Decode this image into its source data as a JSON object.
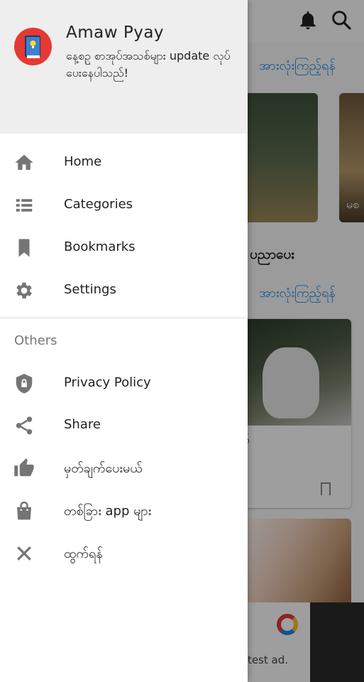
{
  "drawer": {
    "app_name": "Amaw Pyay",
    "subtitle": "နေ့စဥ္ စာအုပ်အသစ်များ update လုပ်ပေးနေပါသည်!",
    "main_items": [
      {
        "label": "Home",
        "icon": "home-icon"
      },
      {
        "label": "Categories",
        "icon": "list-icon"
      },
      {
        "label": "Bookmarks",
        "icon": "bookmark-icon"
      },
      {
        "label": "Settings",
        "icon": "gear-icon"
      }
    ],
    "others_title": "Others",
    "other_items": [
      {
        "label": "Privacy Policy",
        "icon": "shield-lock-icon"
      },
      {
        "label": "Share",
        "icon": "share-icon"
      },
      {
        "label": "မှတ်ချက်ပေးမယ်",
        "icon": "thumbs-up-icon"
      },
      {
        "label": "တစ်ခြား app များ",
        "icon": "shopping-bag-icon"
      },
      {
        "label": "ထွက်ရန်",
        "icon": "close-icon"
      }
    ]
  },
  "background": {
    "see_all_1": "အားလုံးကြည့်ရန်",
    "see_all_2": "အားလုံးကြည့်ရန်",
    "section_title": "ပညာပေး",
    "card_caption": "မစ",
    "article_text": "ပ်",
    "ad_label": "o test ad."
  },
  "colors": {
    "accent": "#1e88e5",
    "avatar": "#e53935",
    "header_bg": "#eeeeee",
    "icon_gray": "#757575"
  }
}
